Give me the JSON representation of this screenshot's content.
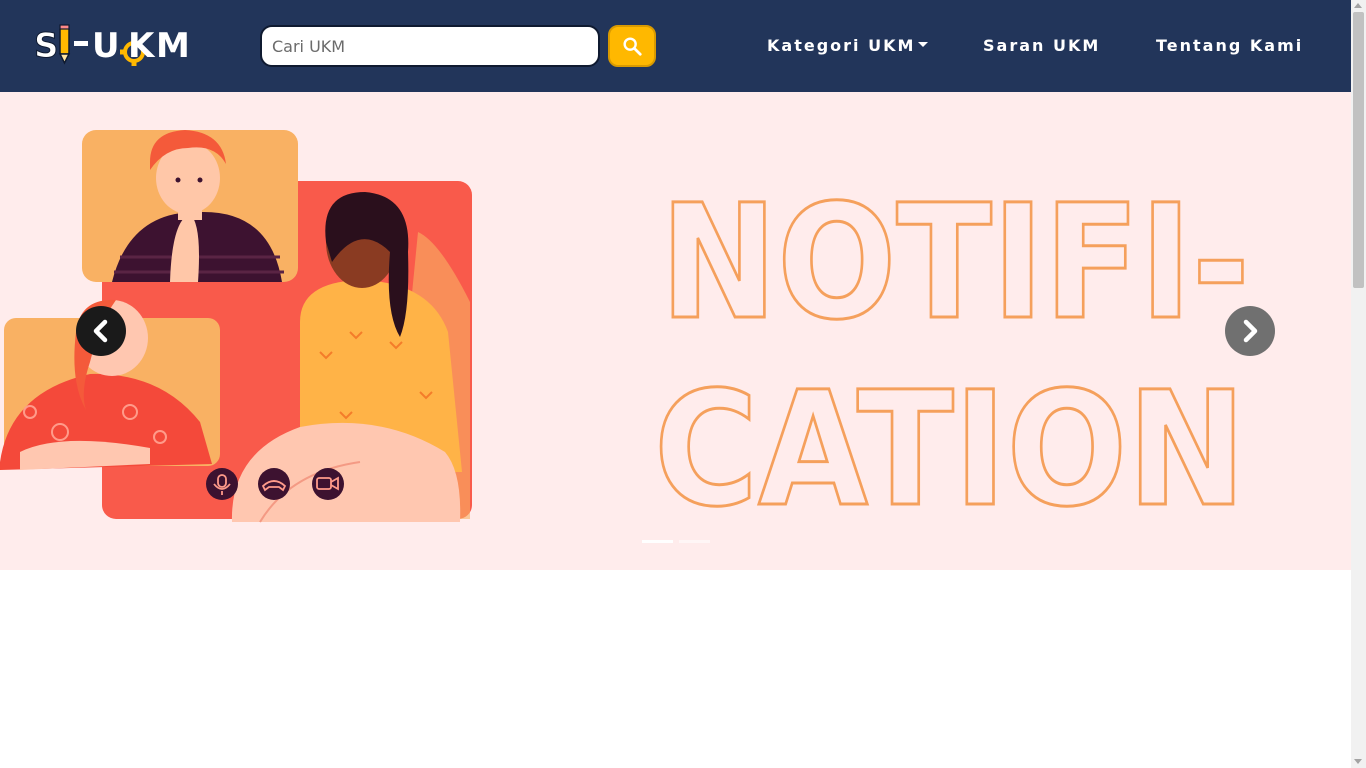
{
  "brand": {
    "logo_text": "SI-UKM",
    "colors": {
      "navbar": "#22355a",
      "accent": "#ffb800",
      "banner_bg": "#ffecec",
      "banner_outline": "#f5a05c"
    }
  },
  "search": {
    "placeholder": "Cari UKM",
    "value": "",
    "button_icon": "search-icon"
  },
  "nav": {
    "items": [
      {
        "label": "Kategori UKM",
        "dropdown": true
      },
      {
        "label": "Saran UKM",
        "dropdown": false
      },
      {
        "label": "Tentang Kami",
        "dropdown": false
      }
    ]
  },
  "carousel": {
    "banner_text_lines": [
      "NOTIFI-",
      "CATION"
    ],
    "illustration": "video-call-illustration",
    "prev_icon": "chevron-left-icon",
    "next_icon": "chevron-right-icon",
    "slide_count": 2,
    "active_slide": 1,
    "call_icons": [
      "microphone-icon",
      "hang-up-icon",
      "video-camera-icon"
    ]
  }
}
